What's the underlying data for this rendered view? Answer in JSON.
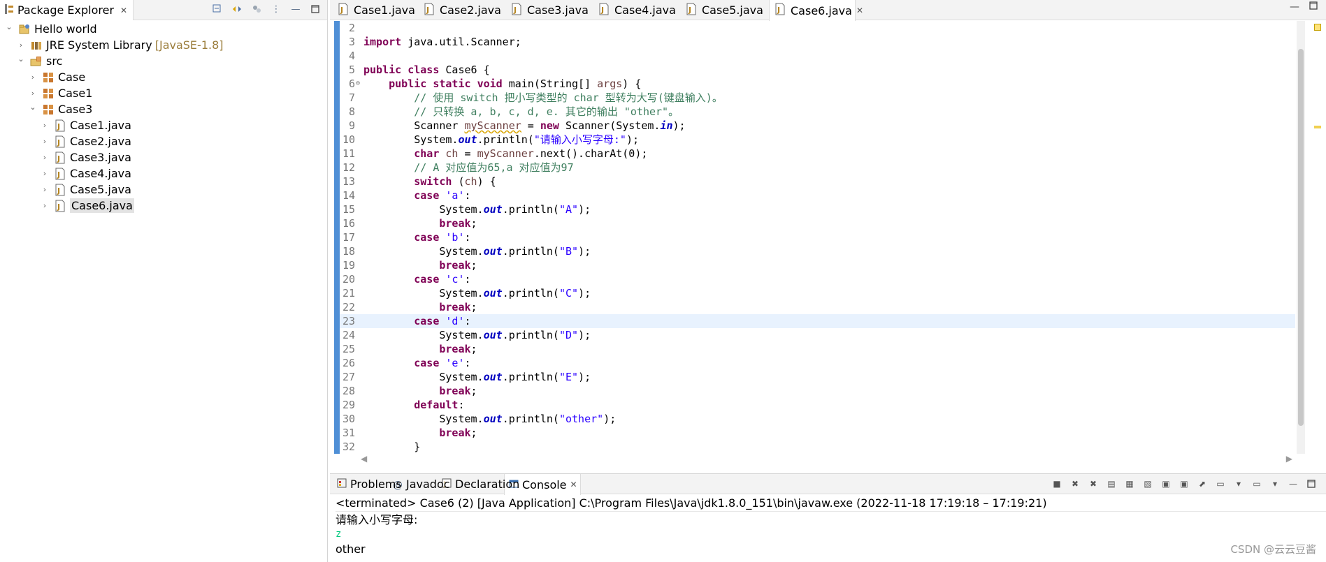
{
  "explorer": {
    "tab_label": "Package Explorer",
    "tree": [
      {
        "label": "Hello world",
        "icon": "project-icon",
        "twisty": "expanded",
        "indent": 0
      },
      {
        "label": "JRE System Library",
        "suffix": "[JavaSE-1.8]",
        "icon": "library-icon",
        "twisty": "collapsed",
        "indent": 1
      },
      {
        "label": "src",
        "icon": "source-folder-icon",
        "twisty": "expanded",
        "indent": 1
      },
      {
        "label": "Case",
        "icon": "package-icon",
        "twisty": "collapsed",
        "indent": 2
      },
      {
        "label": "Case1",
        "icon": "package-icon",
        "twisty": "collapsed",
        "indent": 2
      },
      {
        "label": "Case3",
        "icon": "package-icon",
        "twisty": "expanded",
        "indent": 2
      },
      {
        "label": "Case1.java",
        "icon": "java-file-icon",
        "twisty": "collapsed",
        "indent": 3
      },
      {
        "label": "Case2.java",
        "icon": "java-file-icon",
        "twisty": "collapsed",
        "indent": 3
      },
      {
        "label": "Case3.java",
        "icon": "java-file-icon",
        "twisty": "collapsed",
        "indent": 3
      },
      {
        "label": "Case4.java",
        "icon": "java-file-icon",
        "twisty": "collapsed",
        "indent": 3
      },
      {
        "label": "Case5.java",
        "icon": "java-file-icon",
        "twisty": "collapsed",
        "indent": 3
      },
      {
        "label": "Case6.java",
        "icon": "java-file-icon",
        "twisty": "collapsed",
        "indent": 3,
        "selected": true
      }
    ]
  },
  "editor": {
    "tabs": [
      "Case1.java",
      "Case2.java",
      "Case3.java",
      "Case4.java",
      "Case5.java",
      "Case6.java"
    ],
    "active_tab": 5,
    "current_line": 23,
    "lines": [
      {
        "n": "2",
        "html": ""
      },
      {
        "n": "3",
        "html": "<span class='kw'>import</span> java.util.Scanner;"
      },
      {
        "n": "4",
        "html": ""
      },
      {
        "n": "5",
        "html": "<span class='kw'>public</span> <span class='kw'>class</span> Case6 {"
      },
      {
        "n": "6",
        "fold": true,
        "html": "    <span class='kw'>public</span> <span class='kw'>static</span> <span class='kw'>void</span> main(String[] <span class='vvar'>args</span>) {"
      },
      {
        "n": "7",
        "html": "        <span class='cmt'>// 使用 switch 把小写类型的 char 型转为大写(键盘输入)。</span>"
      },
      {
        "n": "8",
        "html": "        <span class='cmt'>// 只转换 a, b, c, d, e. 其它的输出 \"other\"。</span>"
      },
      {
        "n": "9",
        "warn": true,
        "html": "        Scanner <span class='var-warn'>myScanner</span> = <span class='kw'>new</span> Scanner(System.<span class='fld'>in</span>);"
      },
      {
        "n": "10",
        "html": "        System.<span class='fld'>out</span>.println(<span class='str'>\"请输入小写字母:\"</span>);"
      },
      {
        "n": "11",
        "html": "        <span class='kw'>char</span> <span class='vvar'>ch</span> = <span class='vvar'>myScanner</span>.next().charAt(0);"
      },
      {
        "n": "12",
        "html": "        <span class='cmt'>// A 对应值为65,a 对应值为97</span>"
      },
      {
        "n": "13",
        "html": "        <span class='kw'>switch</span> (<span class='vvar'>ch</span>) {"
      },
      {
        "n": "14",
        "html": "        <span class='kw'>case</span> <span class='str'>'a'</span>:"
      },
      {
        "n": "15",
        "html": "            System.<span class='fld'>out</span>.println(<span class='str'>\"A\"</span>);"
      },
      {
        "n": "16",
        "html": "            <span class='kw'>break</span>;"
      },
      {
        "n": "17",
        "html": "        <span class='kw'>case</span> <span class='str'>'b'</span>:"
      },
      {
        "n": "18",
        "html": "            System.<span class='fld'>out</span>.println(<span class='str'>\"B\"</span>);"
      },
      {
        "n": "19",
        "html": "            <span class='kw'>break</span>;"
      },
      {
        "n": "20",
        "html": "        <span class='kw'>case</span> <span class='str'>'c'</span>:"
      },
      {
        "n": "21",
        "html": "            System.<span class='fld'>out</span>.println(<span class='str'>\"C\"</span>);"
      },
      {
        "n": "22",
        "html": "            <span class='kw'>break</span>;"
      },
      {
        "n": "23",
        "html": "        <span class='kw'>case</span> <span class='str'>'d'</span>:"
      },
      {
        "n": "24",
        "html": "            System.<span class='fld'>out</span>.println(<span class='str'>\"D\"</span>);"
      },
      {
        "n": "25",
        "html": "            <span class='kw'>break</span>;"
      },
      {
        "n": "26",
        "html": "        <span class='kw'>case</span> <span class='str'>'e'</span>:"
      },
      {
        "n": "27",
        "html": "            System.<span class='fld'>out</span>.println(<span class='str'>\"E\"</span>);"
      },
      {
        "n": "28",
        "html": "            <span class='kw'>break</span>;"
      },
      {
        "n": "29",
        "html": "        <span class='kw'>default</span>:"
      },
      {
        "n": "30",
        "html": "            System.<span class='fld'>out</span>.println(<span class='str'>\"other\"</span>);"
      },
      {
        "n": "31",
        "html": "            <span class='kw'>break</span>;"
      },
      {
        "n": "32",
        "html": "        }"
      }
    ]
  },
  "console": {
    "tabs": [
      {
        "label": "Problems",
        "icon": "problems-icon"
      },
      {
        "label": "Javadoc",
        "icon": "javadoc-icon"
      },
      {
        "label": "Declaration",
        "icon": "declaration-icon"
      },
      {
        "label": "Console",
        "icon": "console-icon",
        "active": true
      }
    ],
    "status": "<terminated> Case6 (2) [Java Application] C:\\Program Files\\Java\\jdk1.8.0_151\\bin\\javaw.exe  (2022-11-18 17:19:18 – 17:19:21)",
    "output": [
      {
        "text": "请输入小写字母:",
        "kind": "out"
      },
      {
        "text": "z",
        "kind": "in"
      },
      {
        "text": "other",
        "kind": "out"
      }
    ]
  },
  "watermark": "CSDN @云云豆酱",
  "colors": {
    "keyword": "#7f0055",
    "comment": "#3f7f5f",
    "string": "#2a00ff",
    "field": "#0000c0",
    "change_ruler": "#4f8fd6",
    "current_line": "#e8f2fe",
    "console_input": "#00c87d"
  }
}
